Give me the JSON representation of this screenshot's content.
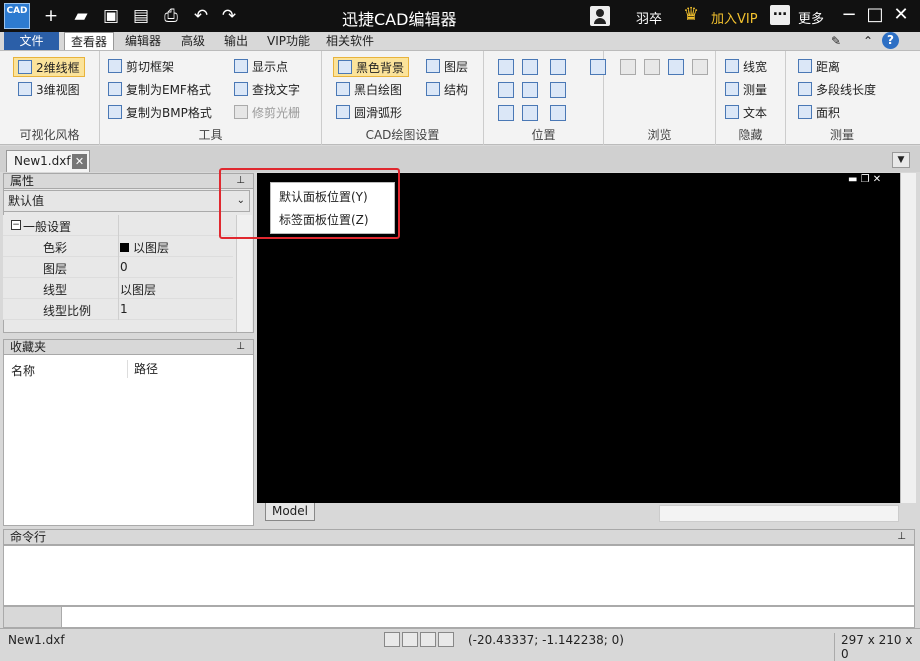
{
  "window": {
    "title": "迅捷CAD编辑器",
    "app_icon_text": "CAD",
    "user_name": "羽卒",
    "vip_label": "加入VIP",
    "more_label": "更多"
  },
  "menu": {
    "file": "文件",
    "tabs": [
      "查看器",
      "编辑器",
      "高级",
      "输出",
      "VIP功能",
      "相关软件"
    ]
  },
  "ribbon": {
    "visual_style": {
      "label": "可视化风格",
      "items": [
        "2维线框",
        "3维视图"
      ]
    },
    "tools": {
      "label": "工具",
      "items": [
        "剪切框架",
        "复制为EMF格式",
        "复制为BMP格式",
        "显示点",
        "查找文字",
        "修剪光栅"
      ]
    },
    "cad_draw": {
      "label": "CAD绘图设置",
      "items": [
        "黑色背景",
        "黑白绘图",
        "圆滑弧形",
        "图层",
        "结构"
      ]
    },
    "position": {
      "label": "位置"
    },
    "browse": {
      "label": "浏览"
    },
    "hide": {
      "label": "隐藏",
      "items": [
        "线宽",
        "测量",
        "文本"
      ]
    },
    "measure": {
      "label": "测量",
      "items": [
        "距离",
        "多段线长度",
        "面积"
      ]
    }
  },
  "doc_tab": {
    "name": "New1.dxf",
    "close": "✕"
  },
  "properties": {
    "title": "属性",
    "combo_value": "默认值",
    "section": "一般设置",
    "rows": [
      {
        "key": "色彩",
        "value": "以图层"
      },
      {
        "key": "图层",
        "value": "0"
      },
      {
        "key": "线型",
        "value": "以图层"
      },
      {
        "key": "线型比例",
        "value": "1"
      }
    ]
  },
  "favorites": {
    "title": "收藏夹",
    "columns": [
      "名称",
      "路径"
    ]
  },
  "context_menu": {
    "items": [
      "默认面板位置(Y)",
      "标签面板位置(Z)"
    ]
  },
  "canvas": {
    "model_tab": "Model"
  },
  "command": {
    "title": "命令行"
  },
  "status": {
    "file": "New1.dxf",
    "coords": "(-20.43337; -1.142238; 0)",
    "paper_size": "297 x 210 x 0"
  },
  "colors": {
    "title_bg": "#111111",
    "accent_blue": "#2b5fa8",
    "selected_bg": "#fbe39a",
    "vip_gold": "#f2c12e",
    "highlight_red": "#e0282f"
  },
  "icons": [
    "app-icon",
    "new-icon",
    "open-icon",
    "save-icon",
    "save-as-icon",
    "print-icon",
    "undo-icon",
    "redo-icon",
    "user-icon",
    "crown-icon",
    "more-icon",
    "minimize-icon",
    "maximize-icon",
    "close-icon",
    "help-icon",
    "pin-icon"
  ]
}
